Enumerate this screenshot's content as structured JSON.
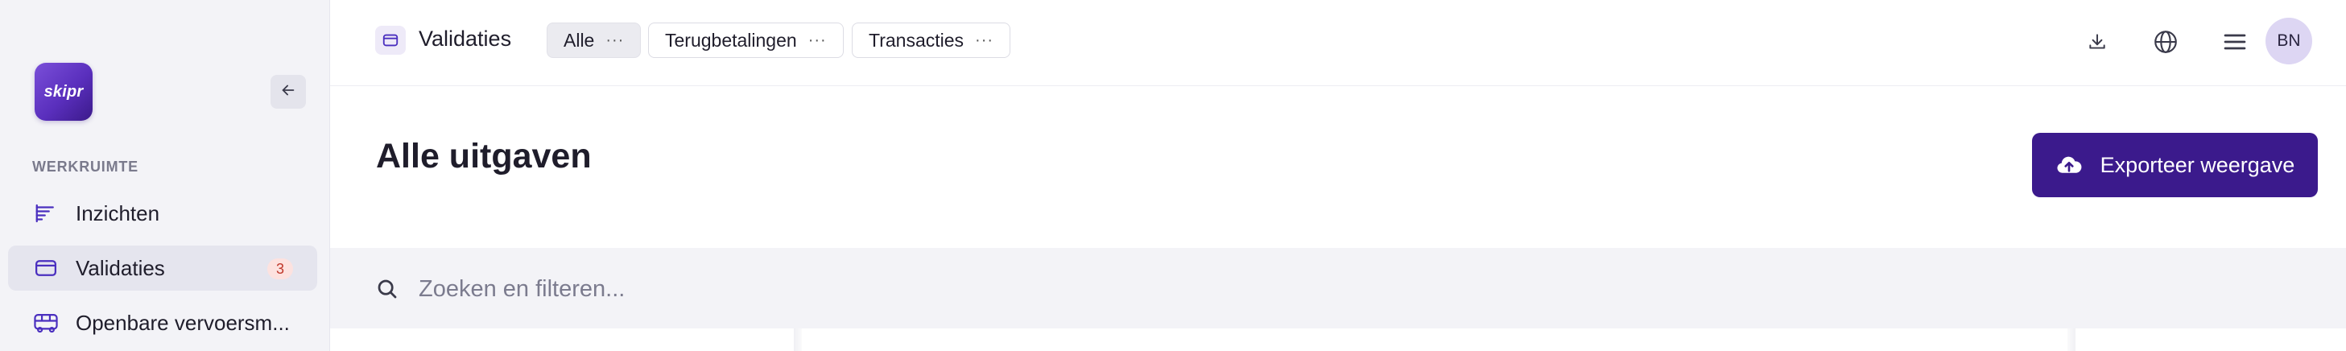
{
  "sidebar": {
    "logo_text": "skipr",
    "section_label": "WERKRUIMTE",
    "items": [
      {
        "label": "Inzichten",
        "icon": "insights-icon"
      },
      {
        "label": "Validaties",
        "icon": "card-icon",
        "badge": "3"
      },
      {
        "label": "Openbare vervoersm...",
        "icon": "bus-icon"
      }
    ]
  },
  "topbar": {
    "page_name": "Validaties",
    "tabs": [
      {
        "label": "Alle"
      },
      {
        "label": "Terugbetalingen"
      },
      {
        "label": "Transacties"
      }
    ],
    "avatar_initials": "BN"
  },
  "main": {
    "title": "Alle uitgaven",
    "export_label": "Exporteer weergave",
    "search_placeholder": "Zoeken en filteren..."
  },
  "colors": {
    "brand": "#3b1a8c",
    "sidebar_bg": "#f3f3f7",
    "badge_bg": "#fde2df",
    "badge_text": "#c0392b"
  }
}
